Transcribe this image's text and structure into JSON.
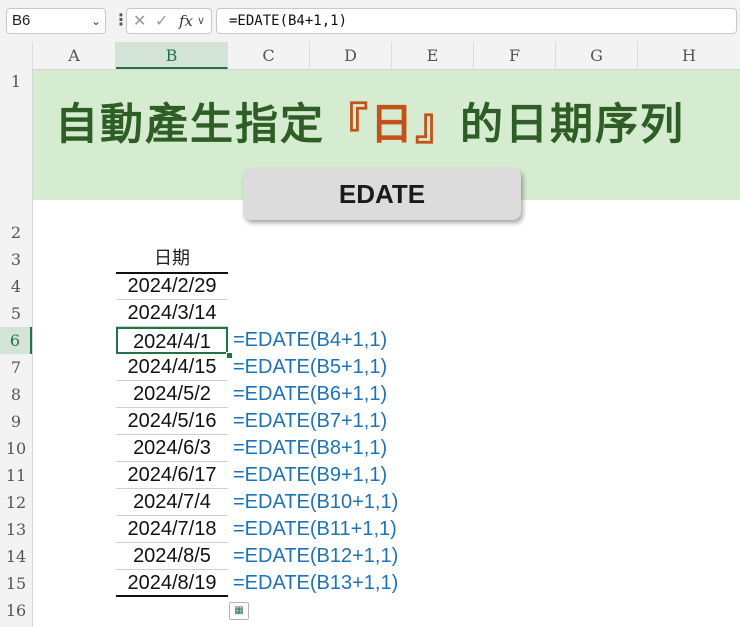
{
  "formula_bar": {
    "name_box": "B6",
    "formula": "=EDATE(B4+1,1)",
    "cancel_glyph": "✕",
    "enter_glyph": "✓",
    "fx_label": "fx",
    "more_glyph": "⋮"
  },
  "columns": [
    "A",
    "B",
    "C",
    "D",
    "E",
    "F",
    "G",
    "H"
  ],
  "rows": [
    "1",
    "2",
    "3",
    "4",
    "5",
    "6",
    "7",
    "8",
    "9",
    "10",
    "11",
    "12",
    "13",
    "14",
    "15",
    "16"
  ],
  "banner": {
    "title_pre": "自動產生指定",
    "title_hl": "『日』",
    "title_post": "的日期序列",
    "function_label": "EDATE",
    "accent_color": "#c4501a",
    "bg_color": "#d5ecd0"
  },
  "sheet": {
    "header": "日期",
    "dates": [
      "2024/2/29",
      "2024/3/14",
      "2024/4/1",
      "2024/4/15",
      "2024/5/2",
      "2024/5/16",
      "2024/6/3",
      "2024/6/17",
      "2024/7/4",
      "2024/7/18",
      "2024/8/5",
      "2024/8/19"
    ],
    "formulas": [
      "=EDATE(B4+1,1)",
      "=EDATE(B5+1,1)",
      "=EDATE(B6+1,1)",
      "=EDATE(B7+1,1)",
      "=EDATE(B8+1,1)",
      "=EDATE(B9+1,1)",
      "=EDATE(B10+1,1)",
      "=EDATE(B11+1,1)",
      "=EDATE(B12+1,1)",
      "=EDATE(B13+1,1)"
    ],
    "formula_color": "#1e73b8",
    "selection_color": "#217346"
  }
}
